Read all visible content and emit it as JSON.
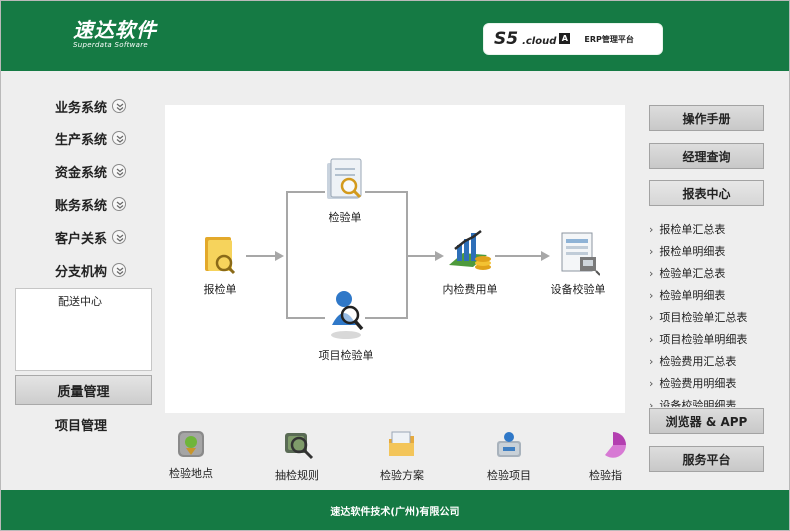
{
  "header": {
    "logo_main": "速达软件",
    "logo_sub": "Superdata Software",
    "brand_s5": "S5",
    "brand_cloud": ".cloud",
    "brand_badge": "A",
    "brand_erp": "ERP管理平台"
  },
  "sidebar": {
    "items": [
      {
        "label": "业务系统",
        "icon": "chevron-down-icon"
      },
      {
        "label": "生产系统",
        "icon": "chevron-down-icon"
      },
      {
        "label": "资金系统",
        "icon": "chevron-down-icon"
      },
      {
        "label": "账务系统",
        "icon": "chevron-down-icon"
      },
      {
        "label": "客户关系",
        "icon": "chevron-down-icon"
      },
      {
        "label": "分支机构",
        "icon": "chevron-down-icon"
      }
    ],
    "sub_panel_item": "配送中心",
    "active_module": "质量管理",
    "next_module": "项目管理"
  },
  "diagram": {
    "report_inspection": "报检单",
    "inspection_sheet": "检验单",
    "project_inspection": "项目检验单",
    "internal_cost": "内检费用单",
    "equipment_calibration": "设备校验单"
  },
  "bottom_bar": {
    "items": [
      {
        "label": "检验地点",
        "icon": "location-icon"
      },
      {
        "label": "抽检规则",
        "icon": "search-rule-icon"
      },
      {
        "label": "检验方案",
        "icon": "folder-plan-icon"
      },
      {
        "label": "检验项目",
        "icon": "project-icon"
      },
      {
        "label": "检验指",
        "icon": "chart-icon"
      }
    ]
  },
  "right_panel": {
    "manual_button": "操作手册",
    "manager_query_button": "经理查询",
    "report_center": "报表中心",
    "reports": [
      "报检单汇总表",
      "报检单明细表",
      "检验单汇总表",
      "检验单明细表",
      "项目检验单汇总表",
      "项目检验单明细表",
      "检验费用汇总表",
      "检验费用明细表",
      "设备校验明细表"
    ],
    "browser_app_button": "浏览器 & APP",
    "service_button": "服务平台"
  },
  "footer": {
    "company": "速达软件技术(广州)有限公司"
  },
  "colors": {
    "brand_green": "#157a44",
    "panel_bg": "#eeeeee"
  }
}
